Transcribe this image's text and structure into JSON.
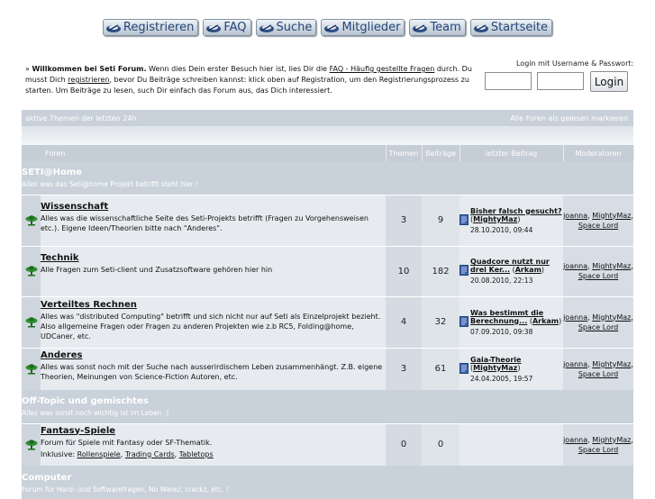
{
  "nav": [
    {
      "label": "Registrieren",
      "icon": "forum-icon"
    },
    {
      "label": "FAQ",
      "icon": "forum-icon"
    },
    {
      "label": "Suche",
      "icon": "forum-icon"
    },
    {
      "label": "Mitglieder",
      "icon": "forum-icon"
    },
    {
      "label": "Team",
      "icon": "forum-icon"
    },
    {
      "label": "Startseite",
      "icon": "forum-icon"
    }
  ],
  "welcome": {
    "prefix": "» ",
    "bold": "Willkommen bei Seti Forum.",
    "t1": " Wenn dies Dein erster Besuch hier ist, lies Dir die ",
    "faq_link": "FAQ - Häufig gestellte Fragen",
    "t2": " durch. Du musst Dich ",
    "reg_link": "registrieren",
    "t3": ", bevor Du Beiträge schreiben kannst: klick oben auf Registration, um den Registrierungsprozess zu starten. Um Beiträge zu lesen, such Dir einfach das Forum aus, das Dich interessiert."
  },
  "login": {
    "title": "Login mit Username & Passwort:",
    "button": "Login"
  },
  "bar": {
    "left": "aktive Themen der letzten 24h",
    "right": "Alle Foren als gelesen markieren"
  },
  "table": {
    "headers": {
      "forums": "Foren",
      "topics": "Themen",
      "posts": "Beiträge",
      "last_post": "letzter Beitrag",
      "moderators": "Moderatoren"
    }
  },
  "categories": [
    {
      "title": "SETI@Home",
      "desc": "Alles was das Seti@home Projekt betrifft steht hier !"
    },
    {
      "title": "Off-Topic und gemischtes",
      "desc": "Alles was sonst noch wichtig ist im Leben :)"
    },
    {
      "title": "Computer",
      "desc": "Forum für Hard- und Softwarefragen, No Warez, crackz, etc. !"
    }
  ],
  "forums": [
    {
      "name": "Wissenschaft",
      "desc": "Alles was die wissenschaftliche Seite des Seti-Projekts betrifft (Fragen zu Vorgehensweisen etc.). Eigene Ideen/Theorien bitte nach \"Anderes\".",
      "topics": "3",
      "posts": "9",
      "last_title": "Bisher falsch gesucht?",
      "last_user": "MightyMaz",
      "last_time": "28.10.2010, 09:44",
      "mod1": "joanna",
      "mod2": "MightyMaz",
      "mod3": "Space Lord"
    },
    {
      "name": "Technik",
      "desc": "Alle Fragen zum Seti-client und Zusatzsoftware gehören hier hin",
      "topics": "10",
      "posts": "182",
      "last_title": "Quadcore nutzt nur drei Ker...",
      "last_user": "Arkam",
      "last_time": "20.08.2010, 22:13",
      "mod1": "joanna",
      "mod2": "MightyMaz",
      "mod3": "Space Lord"
    },
    {
      "name": "Verteiltes Rechnen",
      "desc": "Alles was \"distributed Computing\" betrifft und sich nicht nur auf Seti als Einzelprojekt bezieht. Also allgemeine Fragen oder Fragen zu anderen Projekten wie z.b RC5, Folding@home, UDCaner, etc.",
      "topics": "4",
      "posts": "32",
      "last_title": "Was bestimmt die Berechnung...",
      "last_user": "Arkam",
      "last_time": "07.09.2010, 09:38",
      "mod1": "joanna",
      "mod2": "MightyMaz",
      "mod3": "Space Lord"
    },
    {
      "name": "Anderes",
      "desc": "Alles was sonst noch mit der Suche nach ausserirdischem Leben zusammenhängt. Z.B. eigene Theorien, Meinungen von Science-Fiction Autoren, etc.",
      "topics": "3",
      "posts": "61",
      "last_title": "Gaia-Theorie",
      "last_user": "MightyMaz",
      "last_time": "24.04.2005, 19:57",
      "mod1": "joanna",
      "mod2": "MightyMaz",
      "mod3": "Space Lord"
    },
    {
      "name": "Fantasy-Spiele",
      "desc": "Forum für Spiele mit Fantasy oder SF-Thematik.",
      "sub_label": "Inklusive:",
      "sub1": "Rollenspiele",
      "sub2": "Trading Cards",
      "sub3": "Tabletops",
      "topics": "0",
      "posts": "0",
      "mod1": "joanna",
      "mod2": "MightyMaz",
      "mod3": "Space Lord"
    }
  ],
  "colors": {
    "nav_text": "#24457a",
    "bar_bg": "#c8d0d9",
    "row_bg": "#e7ebef",
    "icon_green": "#1f7a1f"
  }
}
